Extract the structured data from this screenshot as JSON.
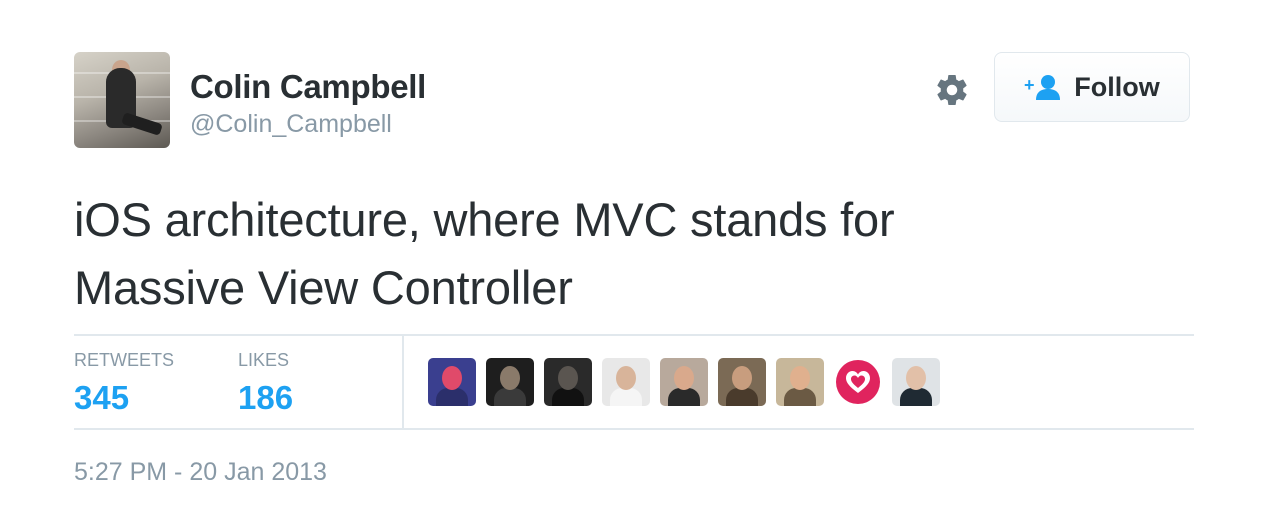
{
  "author": {
    "name": "Colin Campbell",
    "handle": "@Colin_Campbell"
  },
  "actions": {
    "follow_label": "Follow"
  },
  "tweet": {
    "text_line1": "iOS architecture, where MVC stands for",
    "text_line2": "Massive View Controller"
  },
  "stats": {
    "retweets_label": "RETWEETS",
    "retweets_value": "345",
    "likes_label": "LIKES",
    "likes_value": "186"
  },
  "likers": [
    {
      "bg": "#3a3f8f",
      "face": "#e04a6a",
      "body": "#2b2f6b"
    },
    {
      "bg": "#1e1e1e",
      "face": "#8a7a6a",
      "body": "#3a3a3a"
    },
    {
      "bg": "#2a2a2a",
      "face": "#5a5550",
      "body": "#111111"
    },
    {
      "bg": "#e8e8e8",
      "face": "#d8b49a",
      "body": "#f5f5f5"
    },
    {
      "bg": "#b8a99c",
      "face": "#d9a98c",
      "body": "#2a2a2a"
    },
    {
      "bg": "#7b6a55",
      "face": "#c89d7e",
      "body": "#4a3b2c"
    },
    {
      "bg": "#c7b79a",
      "face": "#e0b08e",
      "body": "#6b5a44"
    },
    {
      "bg": "#ffffff",
      "face": "#e0245e",
      "body": "#e0245e"
    },
    {
      "bg": "#dfe3e6",
      "face": "#e2c0a8",
      "body": "#1f2a33"
    }
  ],
  "timestamp": "5:27 PM - 20 Jan 2013",
  "colors": {
    "accent": "#1da1f2",
    "text": "#292f33",
    "muted": "#8899a6",
    "divider": "#e1e8ed"
  },
  "icons": {
    "gear": "gear-icon",
    "follow": "add-user-icon"
  }
}
